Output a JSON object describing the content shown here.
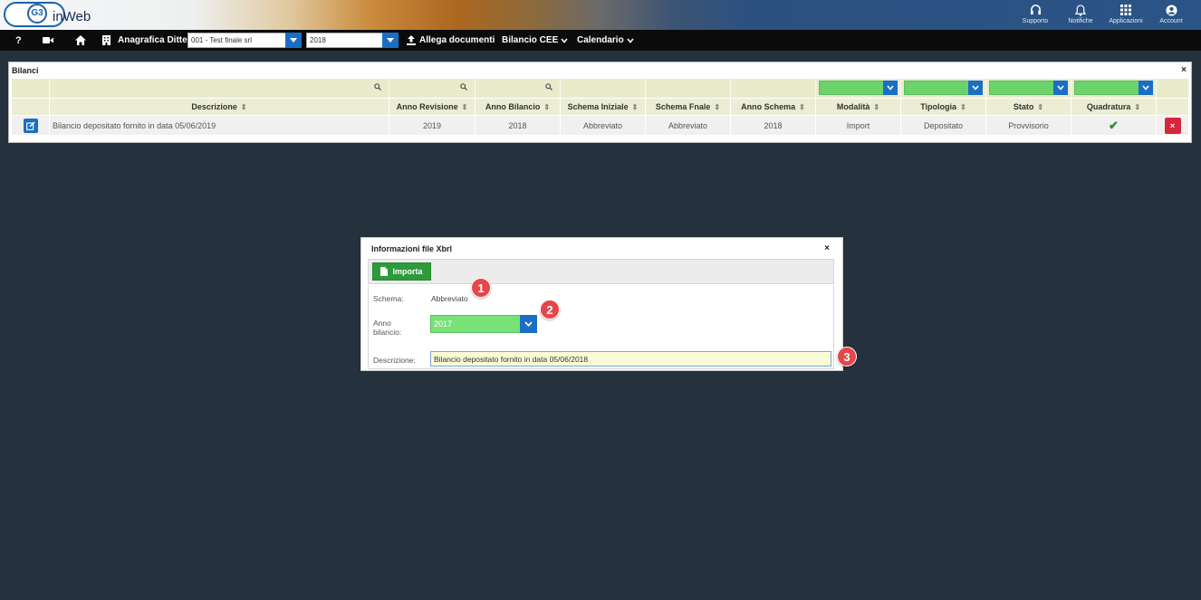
{
  "header": {
    "logo_badge": "G3",
    "logo_text": "inWeb",
    "right_items": [
      {
        "label": "Supporto",
        "icon": "headset-icon"
      },
      {
        "label": "Notifiche",
        "icon": "bell-icon"
      },
      {
        "label": "Applicazioni",
        "icon": "apps-grid-icon"
      },
      {
        "label": "Account",
        "icon": "user-circle-icon"
      }
    ]
  },
  "navbar": {
    "help": "?",
    "anagrafica_label": "Anagrafica Ditte",
    "company_select": "001 - Test finale srl",
    "year_select": "2018",
    "allega_label": "Allega documenti",
    "bilancio_label": "Bilancio CEE",
    "calendario_label": "Calendario"
  },
  "panel": {
    "title": "Bilanci",
    "close": "×",
    "columns": [
      "Descrizione",
      "Anno Revisione",
      "Anno Bilancio",
      "Schema Iniziale",
      "Schema Fnale",
      "Anno Schema",
      "Modalità",
      "Tipologia",
      "Stato",
      "Quadratura"
    ],
    "sort_glyph": "⇕",
    "rows": [
      {
        "descrizione": "Bilancio depositato fornito in data 05/06/2019",
        "anno_revisione": "2019",
        "anno_bilancio": "2018",
        "schema_iniziale": "Abbreviato",
        "schema_finale": "Abbreviato",
        "anno_schema": "2018",
        "modalita": "Import",
        "tipologia": "Depositato",
        "stato": "Provvisorio",
        "quadratura": "✔",
        "delete": "×"
      }
    ]
  },
  "modal": {
    "title": "Informazioni file Xbrl",
    "close": "×",
    "importa_label": "Importa",
    "schema_label": "Schema:",
    "schema_value": "Abbreviato",
    "anno_label_1": "Anno",
    "anno_label_2": "bilancio:",
    "anno_value": "2017",
    "descrizione_label": "Descrizione:",
    "descrizione_value": "Bilancio depositato fornito in data 05/06/2018"
  },
  "markers": [
    "1",
    "2",
    "3"
  ],
  "colors": {
    "accent_blue": "#1a6fc4",
    "success_green": "#2e9b3a",
    "danger_red": "#d6263c",
    "marker_red": "#e5464a",
    "page_bg": "#25313d"
  }
}
